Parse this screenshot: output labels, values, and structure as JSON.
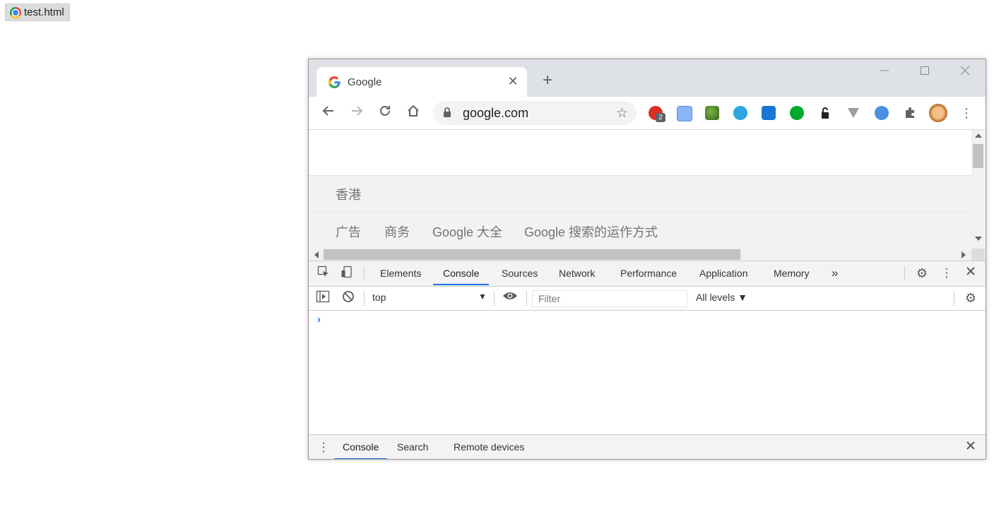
{
  "file_chip": {
    "label": "test.html"
  },
  "browser": {
    "tab_title": "Google",
    "url": "google.com",
    "close_glyph": "✕",
    "new_tab_glyph": "+",
    "extension_badge": "2"
  },
  "page": {
    "region": "香港",
    "footer_links": [
      "广告",
      "商务",
      "Google 大全",
      "Google 搜索的运作方式"
    ]
  },
  "devtools": {
    "tabs": [
      "Elements",
      "Console",
      "Sources",
      "Network",
      "Performance",
      "Application",
      "Memory"
    ],
    "active_tab": "Console",
    "more_glyph": "»",
    "context": "top",
    "filter_placeholder": "Filter",
    "levels": "All levels ▼",
    "prompt_glyph": "›"
  },
  "drawer": {
    "tabs": [
      "Console",
      "Search",
      "Remote devices"
    ],
    "active_tab": "Console"
  },
  "colors": {
    "accent": "#1a73e8",
    "toolbar_bg": "#dee1e6",
    "devtools_bg": "#f3f3f3"
  }
}
